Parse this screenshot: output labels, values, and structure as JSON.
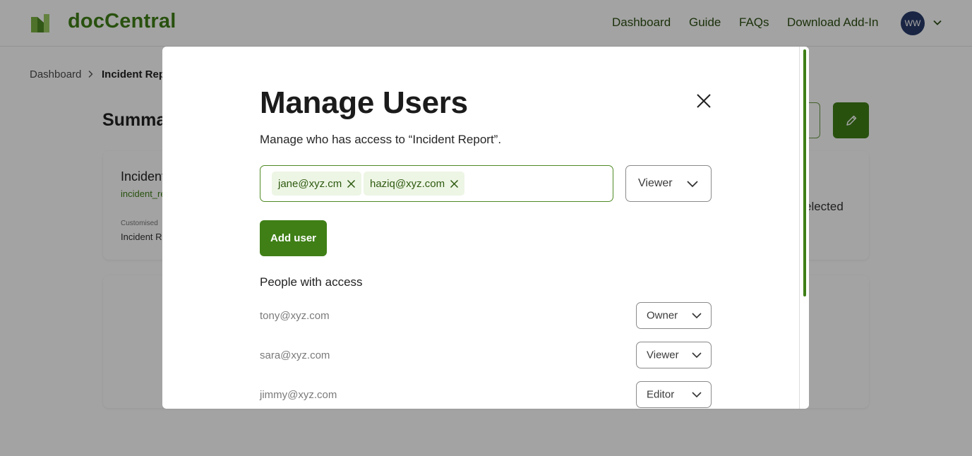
{
  "app": {
    "brand": "docCentral",
    "colors": {
      "brand_green": "#3f7f16",
      "avatar_bg": "#283a6a",
      "chip_bg": "#edf5e4"
    }
  },
  "nav": {
    "dashboard": "Dashboard",
    "guide": "Guide",
    "faqs": "FAQs",
    "download": "Download Add-In",
    "avatar_initials": "WW"
  },
  "breadcrumb": {
    "root": "Dashboard",
    "current": "Incident Repo"
  },
  "page": {
    "title": "Summa",
    "card": {
      "title": "Incident",
      "link": "incident_re",
      "small_label": "Customised",
      "value": "Incident Re",
      "right_text": "elected"
    }
  },
  "modal": {
    "title": "Manage Users",
    "subtitle": "Manage who has access to “Incident Report”.",
    "chips": [
      "jane@xyz.cm",
      "haziq@xyz.com"
    ],
    "role_select": "Viewer",
    "add_button": "Add user",
    "people_heading": "People with access",
    "people": [
      {
        "email": "tony@xyz.com",
        "role": "Owner"
      },
      {
        "email": "sara@xyz.com",
        "role": "Viewer"
      },
      {
        "email": "jimmy@xyz.com",
        "role": "Editor"
      }
    ]
  }
}
